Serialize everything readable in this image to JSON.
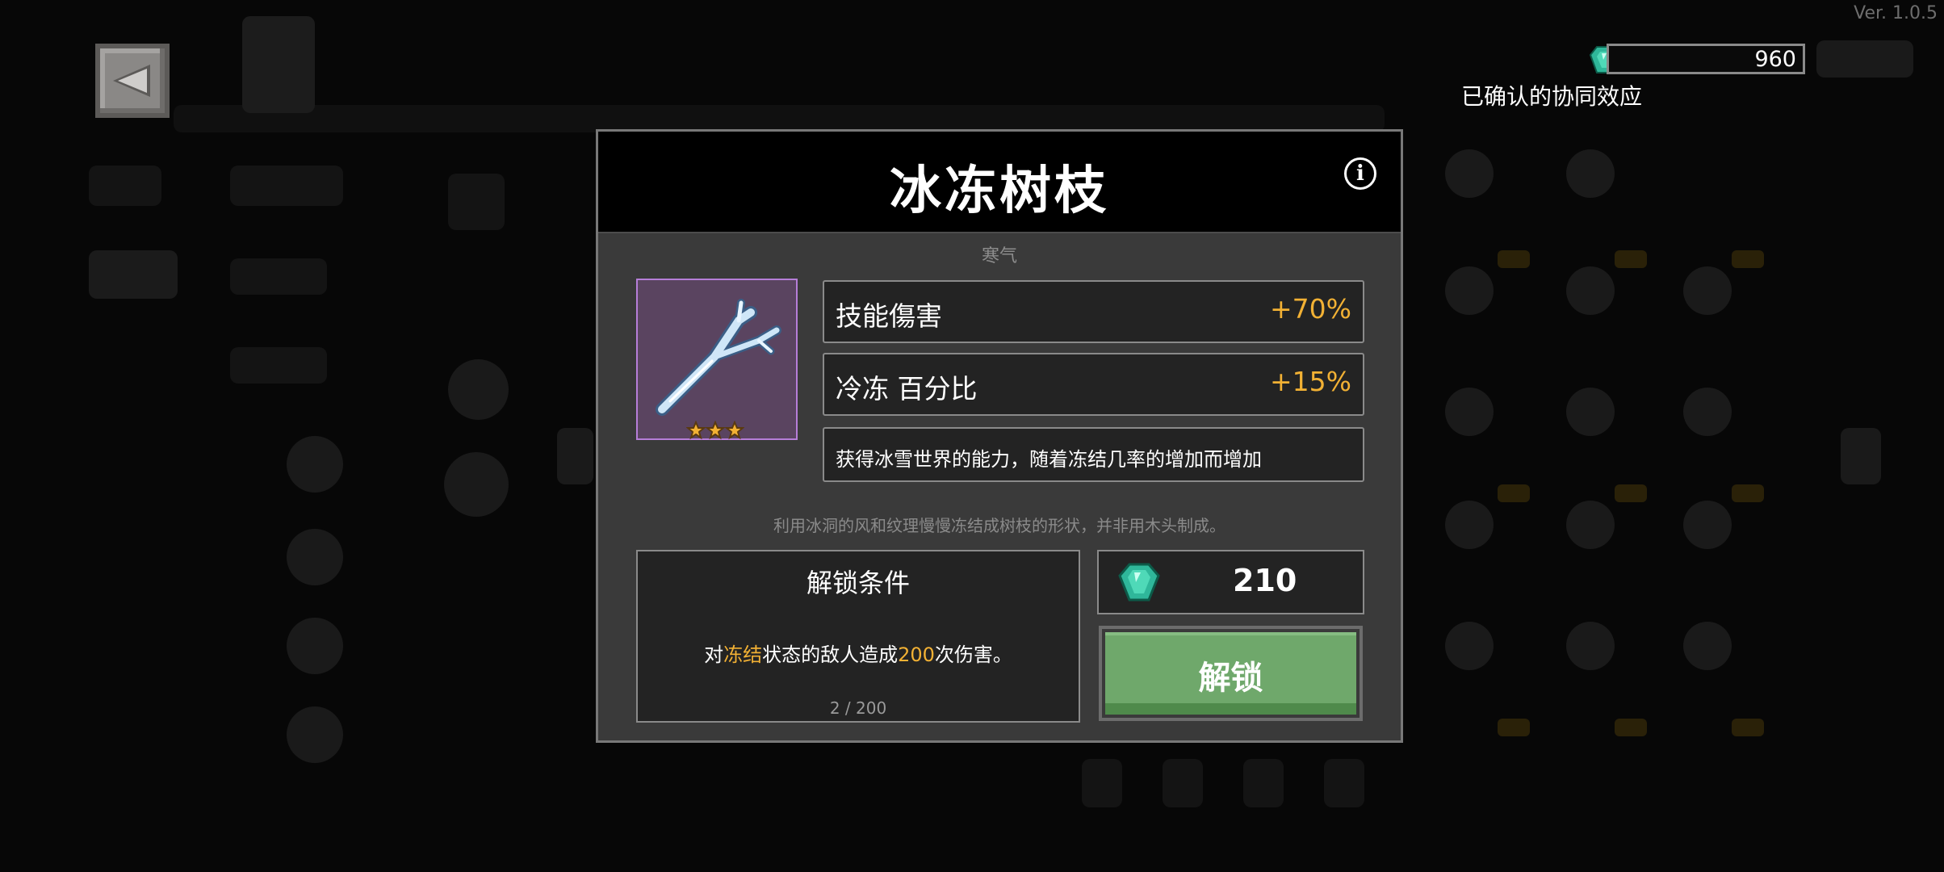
{
  "version": "Ver. 1.0.5",
  "currency": {
    "amount": "960",
    "icon": "gem-icon"
  },
  "synergy_label": "已确认的协同效应",
  "modal": {
    "title": "冰冻树枝",
    "category": "寒气",
    "item": {
      "icon": "frozen-branch-icon",
      "stars": 3
    },
    "stats": [
      {
        "label": "技能傷害",
        "value": "+70%"
      },
      {
        "label": "冷冻 百分比",
        "value": "+15%"
      }
    ],
    "description": "获得冰雪世界的能力，随着冻结几率的增加而增加",
    "flavor": "利用冰洞的风和纹理慢慢冻结成树枝的形状，并非用木头制成。",
    "unlock_condition": {
      "title": "解锁条件",
      "text_prefix": "对",
      "text_highlight1": "冻结",
      "text_middle": "状态的敌人造成",
      "text_highlight2": "200",
      "text_suffix": "次伤害。",
      "progress": "2 / 200"
    },
    "price": {
      "amount": "210",
      "icon": "gem-icon"
    },
    "unlock_button": "解锁"
  },
  "colors": {
    "accent": "#f2b134",
    "button_green": "#6fa86b",
    "item_frame": "#b67ed8",
    "gem": "#2fb79a"
  }
}
